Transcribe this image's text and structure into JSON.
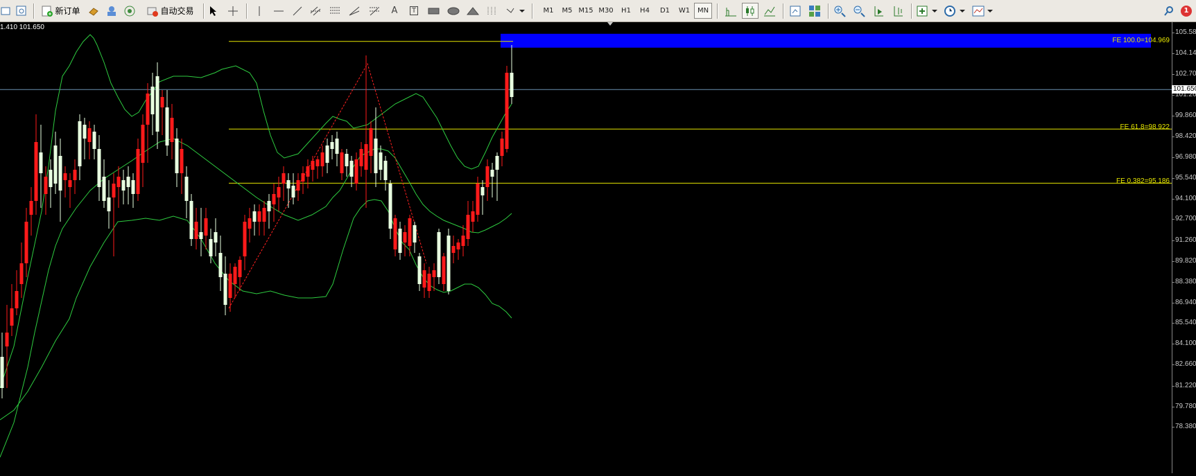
{
  "toolbar": {
    "new_order_label": "新订单",
    "auto_trade_label": "自动交易",
    "tool_text_label": "A",
    "tool_textlabel_label": "T",
    "timeframes": [
      "M1",
      "M5",
      "M15",
      "M30",
      "H1",
      "H4",
      "D1",
      "W1",
      "MN"
    ],
    "active_timeframe": "MN",
    "alert_count": "1"
  },
  "chart": {
    "ohlc_text": "1.410 101.650",
    "current_price": "101.650",
    "price_axis": [
      "105.580",
      "104.140",
      "102.700",
      "101.260",
      "99.860",
      "98.420",
      "96.980",
      "95.540",
      "94.100",
      "92.700",
      "91.260",
      "89.820",
      "88.380",
      "86.940",
      "85.540",
      "84.100",
      "82.660",
      "81.220",
      "79.780",
      "78.380"
    ],
    "price_min": 78.38,
    "price_max": 105.58,
    "fe_levels": [
      {
        "label": "FE 100.0=104.969",
        "price": 104.969,
        "color": "#0000ff"
      },
      {
        "label": "FE 61.8=98.922",
        "price": 98.922,
        "color": "#e6e600"
      },
      {
        "label": "FE 0.382=95.186",
        "price": 95.186,
        "color": "#e6e600"
      }
    ],
    "colors": {
      "bull": "#e8ffe0",
      "bear": "#ff1a1a",
      "band": "#2ecc40",
      "fib": "#e6e600",
      "zigzag": "#ff2020",
      "price_line": "#6a8fb0"
    }
  }
}
